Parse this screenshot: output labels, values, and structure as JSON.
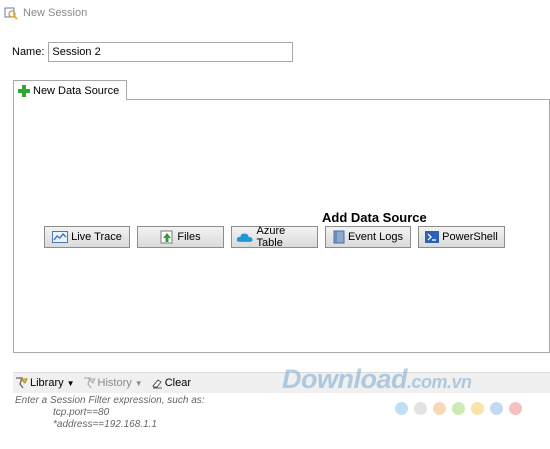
{
  "window": {
    "title": "New Session"
  },
  "session": {
    "name_label": "Name:",
    "name_value": "Session 2"
  },
  "tabs": [
    {
      "label": "New Data Source"
    }
  ],
  "data_source": {
    "heading": "Add Data Source",
    "buttons": [
      {
        "label": "Live Trace",
        "icon": "chart-icon"
      },
      {
        "label": "Files",
        "icon": "upload-file-icon"
      },
      {
        "label": "Azure Table",
        "icon": "cloud-icon"
      },
      {
        "label": "Event Logs",
        "icon": "log-book-icon"
      },
      {
        "label": "PowerShell",
        "icon": "powershell-icon"
      }
    ]
  },
  "toolbar": {
    "library_label": "Library",
    "history_label": "History",
    "clear_label": "Clear"
  },
  "filter": {
    "line1": "Enter a Session Filter expression, such as:",
    "line2": "tcp.port==80",
    "line3": "*address==192.168.1.1"
  },
  "watermark": {
    "text": "Download",
    "suffix": ".com.vn",
    "dot_colors": [
      "#bfe0f2",
      "#e3e3e3",
      "#f7d7b5",
      "#cde9b6",
      "#f8e3a8",
      "#c3d9f2",
      "#f6c0c3"
    ]
  }
}
